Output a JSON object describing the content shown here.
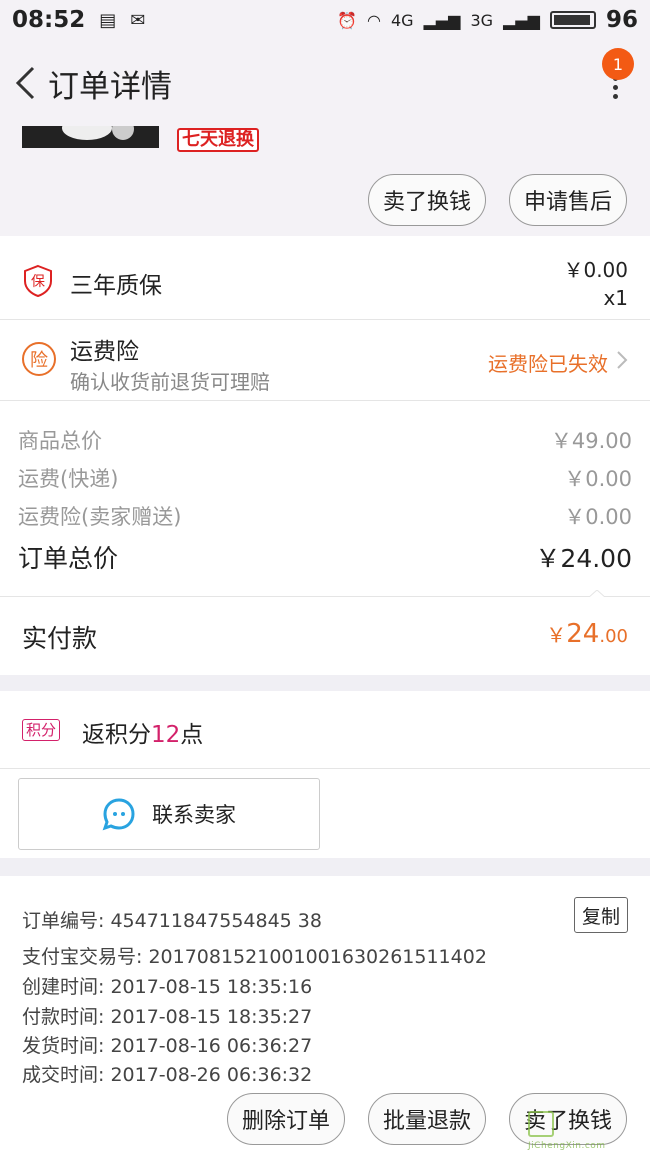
{
  "status_bar": {
    "time": "08:52",
    "battery": "96",
    "net1": "4G",
    "net2": "3G"
  },
  "header": {
    "title": "订单详情",
    "badge_count": "1"
  },
  "product": {
    "return_tag": "七天退换",
    "btn_trade": "卖了换钱",
    "btn_aftersale": "申请售后"
  },
  "warranty": {
    "label": "三年质保",
    "icon_char": "保",
    "price": "￥0.00",
    "qty": "x1"
  },
  "freight_ins": {
    "icon_char": "险",
    "label": "运费险",
    "sub": "确认收货前退货可理赔",
    "status": "运费险已失效"
  },
  "summary": {
    "rows": [
      {
        "label": "商品总价",
        "value": "￥49.00"
      },
      {
        "label": "运费(快递)",
        "value": "￥0.00"
      },
      {
        "label": "运费险(卖家赠送)",
        "value": "￥0.00"
      }
    ],
    "total_label": "订单总价",
    "total_value": "￥24.00"
  },
  "paid": {
    "label": "实付款",
    "symbol": "￥",
    "int": "24",
    "dec": ".00"
  },
  "points": {
    "tag": "积分",
    "prefix": "返积分",
    "num": "12",
    "suffix": "点"
  },
  "contact": {
    "label": "联系卖家"
  },
  "order_info": {
    "order_no": "订单编号: 454711847554845 38",
    "copy_label": "复制",
    "lines": [
      "支付宝交易号: 2017081521001001630261511402",
      "创建时间: 2017-08-15 18:35:16",
      "付款时间: 2017-08-15 18:35:27",
      "发货时间: 2017-08-16 06:36:27",
      "成交时间: 2017-08-26 06:36:32"
    ]
  },
  "footer": {
    "btn_delete": "删除订单",
    "btn_refund": "批量退款",
    "btn_trade": "卖了换钱"
  },
  "watermark": {
    "text": "JiChengXin.com"
  },
  "colors": {
    "accent": "#e8702a",
    "points": "#d3216a",
    "badge": "#f35a14"
  }
}
